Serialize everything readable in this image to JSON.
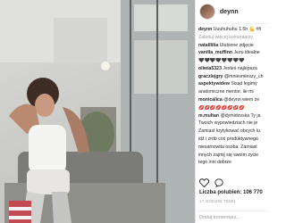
{
  "post": {
    "username": "deynn",
    "caption_user": "deynn",
    "caption_text": "Uuuhuhuhu 1.5h 💪 #fi",
    "load_more": "Załaduj więcej komentarzy",
    "comments": [
      {
        "user": "natalllilia",
        "text": "Ulubione zdjęcie"
      },
      {
        "user": "vanilla_muffinn",
        "text": "Jezu idealne"
      },
      {
        "user": "",
        "text": "🖤🖤🖤🖤🖤🖤🖤🖤"
      },
      {
        "user": "oliwia5323",
        "text": "Jesteś najlepsza"
      },
      {
        "user": "graczlejgry",
        "text": "@mniesmieszy_ch"
      },
      {
        "user": "aspektywidew",
        "text": "Sisąd legimy"
      },
      {
        "user": "",
        "text": "anatomiczne mentor. ile mi"
      },
      {
        "user": "monicalica",
        "text": "@deynn wiem że"
      },
      {
        "user": "",
        "text": "💋💋💋💋💋💋💋💋"
      },
      {
        "user": "m.multan",
        "text": "@dymidovska Ty ja"
      },
      {
        "user": "",
        "text": "Twoich wypowiedziach nie je"
      },
      {
        "user": "",
        "text": "Zamiast krytykować obcych lu"
      },
      {
        "user": "",
        "text": "idź i zrób coś produktywnego"
      },
      {
        "user": "",
        "text": "niesamowita osoba. Zamiast"
      },
      {
        "user": "",
        "text": "innych zajmij się swoim życie"
      },
      {
        "user": "",
        "text": "tego inni dobrze"
      }
    ],
    "likes": "Liczba polubień: 106 770",
    "date": "17 GODZIN TEMU",
    "add_comment_placeholder": "Dodaj komentarz..."
  }
}
